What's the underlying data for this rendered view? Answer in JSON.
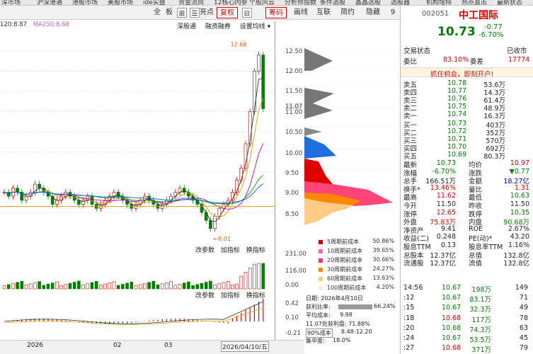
{
  "topnav": [
    "深市场",
    "沪深港通",
    "港股市场",
    "美股市场",
    "ide实盘",
    "资金流向",
    "12核心内参",
    "个股风云",
    "分析师指数",
    "条件选股",
    "晶晶选股",
    "选股器",
    "机构增持",
    "热点直击",
    "最新状态"
  ],
  "toolbar": {
    "items": [
      "全",
      "板",
      "⊞",
      "☰",
      "⊟"
    ],
    "factor_label": "亮点",
    "right_label": "复权",
    "chips_label": "筹码",
    "btn_a": "画线",
    "btn_b": "互联",
    "btn_c": "简约",
    "btn_d": "隐藏",
    "nine": "9"
  },
  "ma_legend": {
    "ma120": "120:8.87",
    "ma250": "MA250:8.68"
  },
  "chart_toolbar": {
    "a": "深股通",
    "b": "融资融券",
    "c": "设置均线"
  },
  "price_scale": [
    "12.50",
    "12.00",
    "11.50",
    "11.07",
    "11.00",
    "10.50",
    "10.00",
    "9.50",
    "9.00",
    "8.50"
  ],
  "price_markers": {
    "high": "12.68",
    "low": "8.01"
  },
  "vol_bar": {
    "a": "改参数",
    "b": "加指标",
    "c": "换指标"
  },
  "vol_scale": [
    "231.00",
    "116.00",
    "0.00"
  ],
  "macd_bar": {
    "a": "改参数",
    "b": "加指标",
    "c": "换指标"
  },
  "macd_scale": [
    "0.42",
    "0.10",
    "-0.21"
  ],
  "x_axis": {
    "a": "2026",
    "b": "02",
    "c": "03",
    "d": "2026/04/10/五"
  },
  "chip_legend": [
    {
      "name": "5周期前成本",
      "pct": "50.86%",
      "color": "#cc0000"
    },
    {
      "name": "10周期前成本",
      "pct": "39.65%",
      "color": "#ff66aa"
    },
    {
      "name": "20周期前成本",
      "pct": "30.66%",
      "color": "#ff3366"
    },
    {
      "name": "30周期前成本",
      "pct": "24.27%",
      "color": "#ff8800"
    },
    {
      "name": "60周期前成本",
      "pct": "13.63%",
      "color": "#ffcc66"
    },
    {
      "name": "100周期前成本",
      "pct": "4.20%",
      "color": "#ffeecc"
    }
  ],
  "chip_info": {
    "date": "日期: 2026年4月10日",
    "profit_label": "获利比率:",
    "profit_val": "66.24%",
    "avg_label": "平均成本:",
    "avg_val": "9.98",
    "profit2": "11.07处获利盘: 71.88%",
    "c90": "90%成本",
    "c90_val": "8.48-12.20",
    "conc": "集中度:",
    "conc_val": "18.0%"
  },
  "stock": {
    "code": "002051",
    "name": "中工国际",
    "price": "10.73",
    "chg": "-0.77",
    "chg_pct": "-6.70%"
  },
  "status_row": {
    "label": "交易状态",
    "val": "已收市"
  },
  "weibi": {
    "label": "委比",
    "val": "83.10%",
    "label2": "委差",
    "val2": "17774"
  },
  "promo": "抓住机会，即刻开户!",
  "asks": [
    {
      "l": "卖五",
      "p": "10.78",
      "v": "53.6万"
    },
    {
      "l": "卖四",
      "p": "10.77",
      "v": "14.3万"
    },
    {
      "l": "卖三",
      "p": "10.76",
      "v": "61.4万"
    },
    {
      "l": "卖二",
      "p": "10.75",
      "v": "48.9万"
    },
    {
      "l": "卖一",
      "p": "10.74",
      "v": "16.3万"
    }
  ],
  "bids": [
    {
      "l": "买一",
      "p": "10.73",
      "v": "403万"
    },
    {
      "l": "买二",
      "p": "10.72",
      "v": "352万"
    },
    {
      "l": "买三",
      "p": "10.71",
      "v": "570万"
    },
    {
      "l": "买四",
      "p": "10.70",
      "v": "692万"
    },
    {
      "l": "买五",
      "p": "10.69",
      "v": "80.3万"
    }
  ],
  "quotes": [
    {
      "a": "最新",
      "b": "10.73",
      "c": "均价",
      "d": "10.97"
    },
    {
      "a": "涨幅",
      "b": "-6.70%",
      "c": "涨跌",
      "d": "▼0.77"
    },
    {
      "a": "总手",
      "b": "166.51万",
      "c": "金额",
      "d": "18.27亿"
    },
    {
      "a": "换手*",
      "b": "13.46%",
      "c": "量比",
      "d": "1.31"
    },
    {
      "a": "最高",
      "b": "11.62",
      "c": "最低",
      "d": "10.63"
    },
    {
      "a": "今开",
      "b": "11.50",
      "c": "昨收",
      "d": "11.50"
    },
    {
      "a": "涨停",
      "b": "12.65",
      "c": "跌停",
      "d": "10.35"
    },
    {
      "a": "外盘",
      "b": "75.83万",
      "c": "内盘",
      "d": "90.68万"
    },
    {
      "a": "净资产",
      "b": "9.41",
      "c": "ROE",
      "d": "2.67%"
    },
    {
      "a": "收益(二)",
      "b": "0.248",
      "c": "PE(动)*",
      "d": "43.20"
    },
    {
      "a": "股息TTM",
      "b": "0.13",
      "c": "股息率TTM",
      "d": "1.16%"
    },
    {
      "a": "总股本",
      "b": "12.37亿",
      "c": "总值",
      "d": "132.8亿"
    },
    {
      "a": "流通股",
      "b": "12.37亿",
      "c": "流值",
      "d": "132.8亿"
    }
  ],
  "ticks": [
    {
      "t": "14:56",
      "p": "10.67",
      "v": "198万",
      "n": "149"
    },
    {
      "t": ":12",
      "p": "10.67",
      "v": "83.1万",
      "n": "71"
    },
    {
      "t": ":15",
      "p": "10.67",
      "v": "32.3万",
      "n": "49"
    },
    {
      "t": ":18",
      "p": "10.68",
      "v": "117万",
      "n": "78"
    },
    {
      "t": ":20",
      "p": "10.68",
      "v": "74.3万",
      "n": "63"
    },
    {
      "t": ":24",
      "p": "10.67",
      "v": "53.5万",
      "n": "45"
    },
    {
      "t": ":27",
      "p": "10.68",
      "v": "371万",
      "n": "79"
    }
  ]
}
